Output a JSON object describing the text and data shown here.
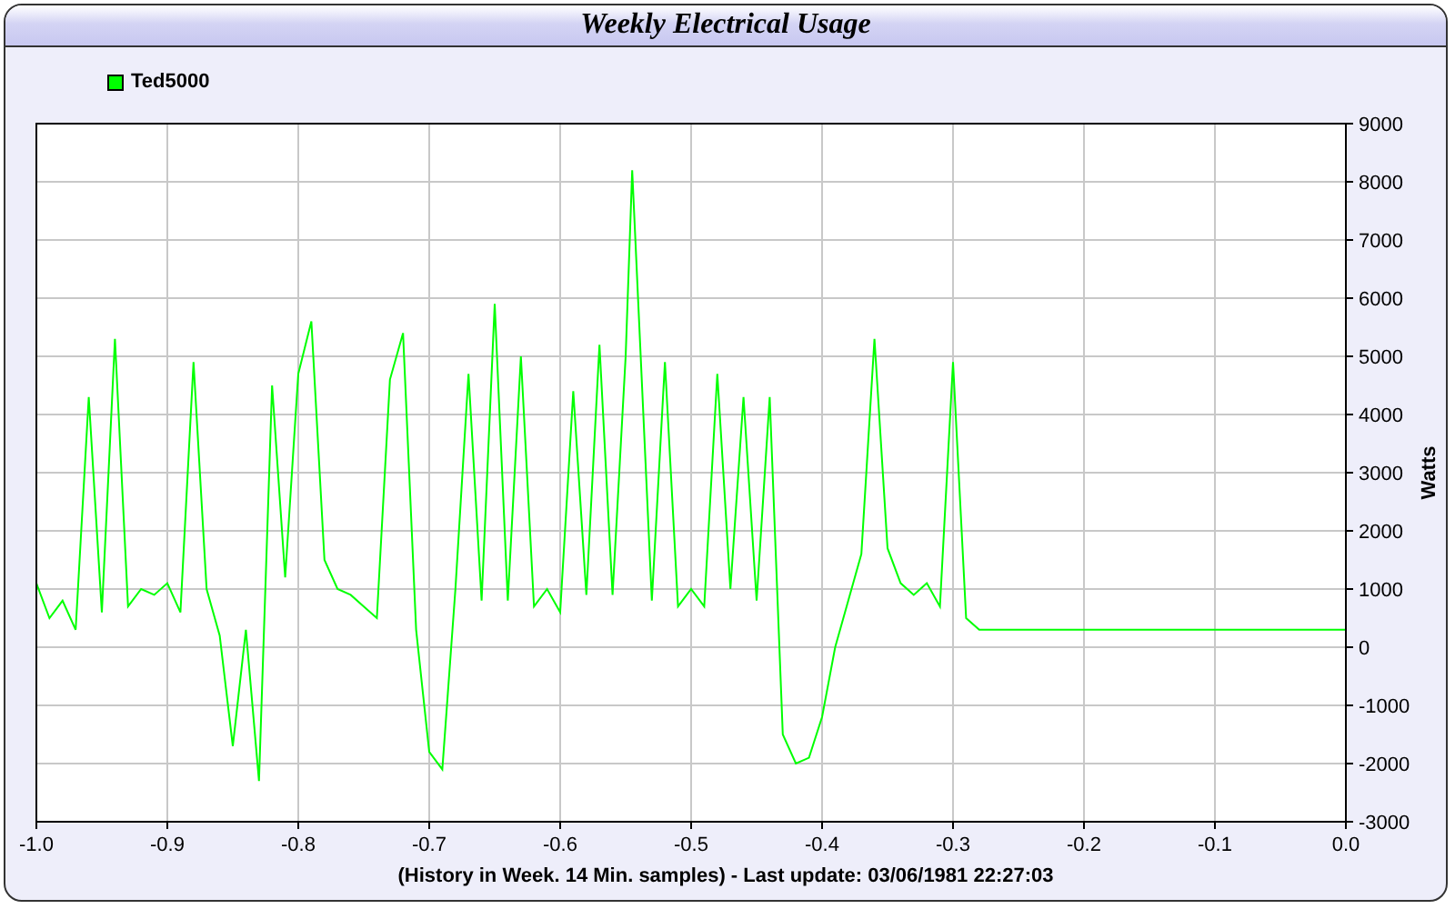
{
  "chart_data": {
    "type": "line",
    "grid": true,
    "title": "Weekly Electrical Usage",
    "xlabel": "(History in Week. 14 Min. samples) - Last update: 03/06/1981 22:27:03",
    "ylabel": "Watts",
    "x": [
      -1.0,
      -0.99,
      -0.98,
      -0.97,
      -0.96,
      -0.95,
      -0.94,
      -0.93,
      -0.92,
      -0.91,
      -0.9,
      -0.89,
      -0.88,
      -0.87,
      -0.86,
      -0.85,
      -0.84,
      -0.83,
      -0.82,
      -0.81,
      -0.8,
      -0.79,
      -0.78,
      -0.77,
      -0.76,
      -0.75,
      -0.74,
      -0.73,
      -0.72,
      -0.71,
      -0.7,
      -0.69,
      -0.68,
      -0.67,
      -0.66,
      -0.65,
      -0.64,
      -0.63,
      -0.62,
      -0.61,
      -0.6,
      -0.59,
      -0.58,
      -0.57,
      -0.56,
      -0.55,
      -0.545,
      -0.53,
      -0.52,
      -0.51,
      -0.5,
      -0.49,
      -0.48,
      -0.47,
      -0.46,
      -0.45,
      -0.44,
      -0.43,
      -0.42,
      -0.41,
      -0.4,
      -0.39,
      -0.38,
      -0.37,
      -0.36,
      -0.35,
      -0.34,
      -0.33,
      -0.32,
      -0.31,
      -0.3,
      -0.29,
      -0.28,
      0.0
    ],
    "series": [
      {
        "name": "Ted5000",
        "color": "#00ff00",
        "values": [
          1100,
          500,
          800,
          300,
          4300,
          600,
          5300,
          700,
          1000,
          900,
          1100,
          600,
          4900,
          1000,
          200,
          -1700,
          300,
          -2300,
          4500,
          1200,
          4700,
          5600,
          1500,
          1000,
          900,
          700,
          500,
          4600,
          5400,
          300,
          -1800,
          -2100,
          1000,
          4700,
          800,
          5900,
          800,
          5000,
          700,
          1000,
          600,
          4400,
          900,
          5200,
          900,
          5000,
          8200,
          800,
          4900,
          700,
          1000,
          700,
          4700,
          1000,
          4300,
          800,
          4300,
          -1500,
          -2000,
          -1900,
          -1200,
          0,
          800,
          1600,
          5300,
          1700,
          1100,
          900,
          1100,
          700,
          4900,
          500,
          300,
          300
        ]
      }
    ],
    "xlim": [
      -1.0,
      0.0
    ],
    "ylim": [
      -3000,
      9000
    ],
    "xticks": [
      {
        "value": -1.0,
        "label": "-1.0"
      },
      {
        "value": -0.9,
        "label": "-0.9"
      },
      {
        "value": -0.8,
        "label": "-0.8"
      },
      {
        "value": -0.7,
        "label": "-0.7"
      },
      {
        "value": -0.6,
        "label": "-0.6"
      },
      {
        "value": -0.5,
        "label": "-0.5"
      },
      {
        "value": -0.4,
        "label": "-0.4"
      },
      {
        "value": -0.3,
        "label": "-0.3"
      },
      {
        "value": -0.2,
        "label": "-0.2"
      },
      {
        "value": -0.1,
        "label": "-0.1"
      },
      {
        "value": 0.0,
        "label": "0.0"
      }
    ],
    "yticks": [
      -3000,
      -2000,
      -1000,
      0,
      1000,
      2000,
      3000,
      4000,
      5000,
      6000,
      7000,
      8000,
      9000
    ]
  }
}
